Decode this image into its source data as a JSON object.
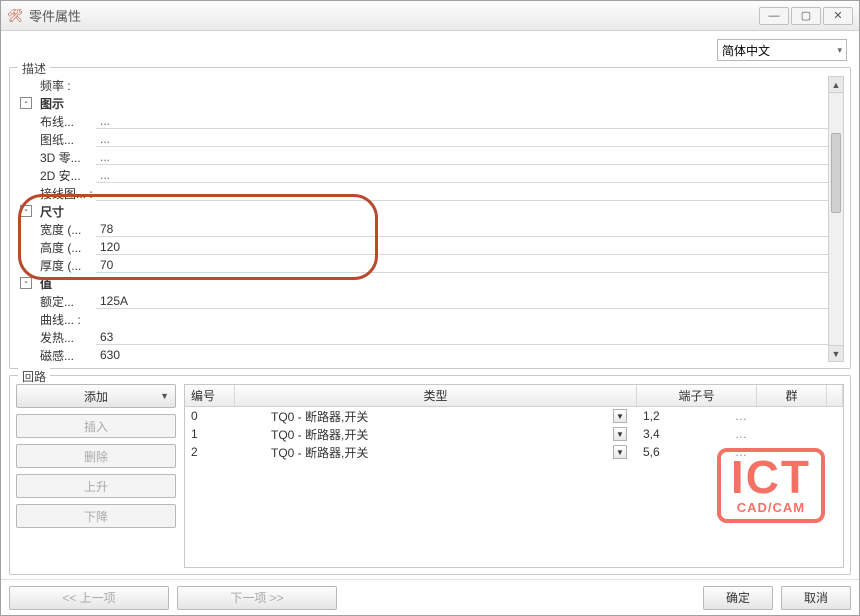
{
  "window": {
    "title": "零件属性"
  },
  "language": {
    "selected": "简体中文"
  },
  "description": {
    "legend": "描述",
    "rows": [
      {
        "kind": "leaf",
        "label": "频率 :",
        "value": "",
        "noval": true
      },
      {
        "kind": "group",
        "expander": "-",
        "label": "图示"
      },
      {
        "kind": "leaf",
        "label": "布线...",
        "value": "...",
        "dots": true
      },
      {
        "kind": "leaf",
        "label": "图纸...",
        "value": "...",
        "dots": true
      },
      {
        "kind": "leaf",
        "label": "3D 零...",
        "value": "...",
        "dots": true
      },
      {
        "kind": "leaf",
        "label": "2D 安...",
        "value": "...",
        "dots": true
      },
      {
        "kind": "leaf",
        "label": "接线图... :",
        "value": "...",
        "dots": true
      },
      {
        "kind": "group",
        "expander": "-",
        "label": "尺寸"
      },
      {
        "kind": "leaf",
        "label": "宽度 (...",
        "value": "78"
      },
      {
        "kind": "leaf",
        "label": "高度 (...",
        "value": "120"
      },
      {
        "kind": "leaf",
        "label": "厚度 (...",
        "value": "70"
      },
      {
        "kind": "group",
        "expander": "-",
        "label": "值"
      },
      {
        "kind": "leaf",
        "label": "额定...",
        "value": "125A"
      },
      {
        "kind": "leaf",
        "label": "曲线... :",
        "value": "",
        "noval": true
      },
      {
        "kind": "leaf",
        "label": "发热...",
        "value": "63"
      },
      {
        "kind": "leaf",
        "label": "磁感...",
        "value": "630"
      }
    ]
  },
  "circuits": {
    "legend": "回路",
    "buttons": {
      "add": "添加",
      "insert": "插入",
      "delete": "删除",
      "up": "上升",
      "down": "下降"
    },
    "grid": {
      "headers": {
        "num": "编号",
        "type": "类型",
        "terminal": "端子号",
        "group": "群"
      },
      "rows": [
        {
          "num": "0",
          "type": "TQ0 - 断路器,开关",
          "terminal": "1,2",
          "group": ""
        },
        {
          "num": "1",
          "type": "TQ0 - 断路器,开关",
          "terminal": "3,4",
          "group": ""
        },
        {
          "num": "2",
          "type": "TQ0 - 断路器,开关",
          "terminal": "5,6",
          "group": ""
        }
      ]
    }
  },
  "footer": {
    "prev": "<< 上一项",
    "next": "下一项 >>",
    "ok": "确定",
    "cancel": "取消"
  },
  "watermark": {
    "big": "ICT",
    "small": "CAD/CAM"
  }
}
